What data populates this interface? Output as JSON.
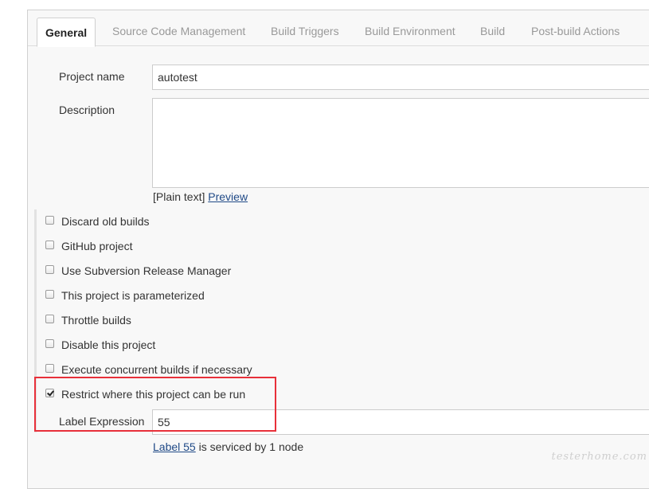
{
  "tabs": [
    "General",
    "Source Code Management",
    "Build Triggers",
    "Build Environment",
    "Build",
    "Post-build Actions"
  ],
  "project_name": {
    "label": "Project name",
    "value": "autotest"
  },
  "description": {
    "label": "Description",
    "value": ""
  },
  "format": {
    "plain_text": "[Plain text]",
    "preview": "Preview"
  },
  "options": [
    {
      "label": "Discard old builds",
      "checked": false
    },
    {
      "label": "GitHub project",
      "checked": false
    },
    {
      "label": "Use Subversion Release Manager",
      "checked": false
    },
    {
      "label": "This project is parameterized",
      "checked": false
    },
    {
      "label": "Throttle builds",
      "checked": false
    },
    {
      "label": "Disable this project",
      "checked": false
    },
    {
      "label": "Execute concurrent builds if necessary",
      "checked": false
    },
    {
      "label": "Restrict where this project can be run",
      "checked": true
    }
  ],
  "label_expression": {
    "label": "Label Expression",
    "value": "55"
  },
  "label_status": {
    "link": "Label 55",
    "text": " is serviced by 1 node"
  },
  "watermark": "testerhome.com",
  "colors": {
    "highlight": "#e8303a",
    "link": "#204a87"
  }
}
